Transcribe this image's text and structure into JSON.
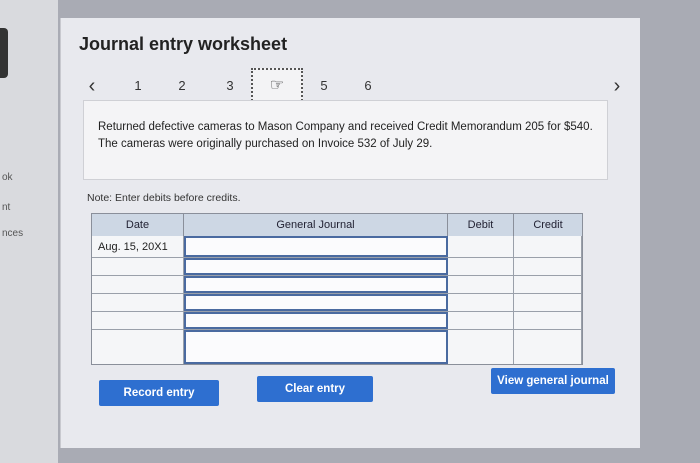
{
  "left_strip": {
    "labels": [
      "ok",
      "nt",
      "nces"
    ]
  },
  "worksheet": {
    "title": "Journal entry worksheet",
    "prev_icon": "chevron-left-icon",
    "next_icon": "chevron-right-icon",
    "tabs": [
      "1",
      "2",
      "3",
      "",
      "5",
      "6"
    ],
    "active_tab_icon": "hand-pointer-icon",
    "description": "Returned defective cameras to Mason Company and received Credit Memorandum 205 for $540. The cameras were originally purchased on Invoice 532 of July 29.",
    "note": "Note: Enter debits before credits."
  },
  "table": {
    "headers": {
      "date": "Date",
      "general_journal": "General Journal",
      "debit": "Debit",
      "credit": "Credit"
    },
    "rows": [
      {
        "date": "Aug. 15, 20X1",
        "account": "",
        "debit": "",
        "credit": ""
      },
      {
        "date": "",
        "account": "",
        "debit": "",
        "credit": ""
      },
      {
        "date": "",
        "account": "",
        "debit": "",
        "credit": ""
      },
      {
        "date": "",
        "account": "",
        "debit": "",
        "credit": ""
      },
      {
        "date": "",
        "account": "",
        "debit": "",
        "credit": ""
      },
      {
        "date": "",
        "account": "",
        "debit": "",
        "credit": ""
      }
    ]
  },
  "buttons": {
    "record": "Record entry",
    "clear": "Clear entry",
    "view": "View general journal"
  },
  "colors": {
    "button": "#2e6fd0",
    "header_bg": "#cdd7e4"
  }
}
